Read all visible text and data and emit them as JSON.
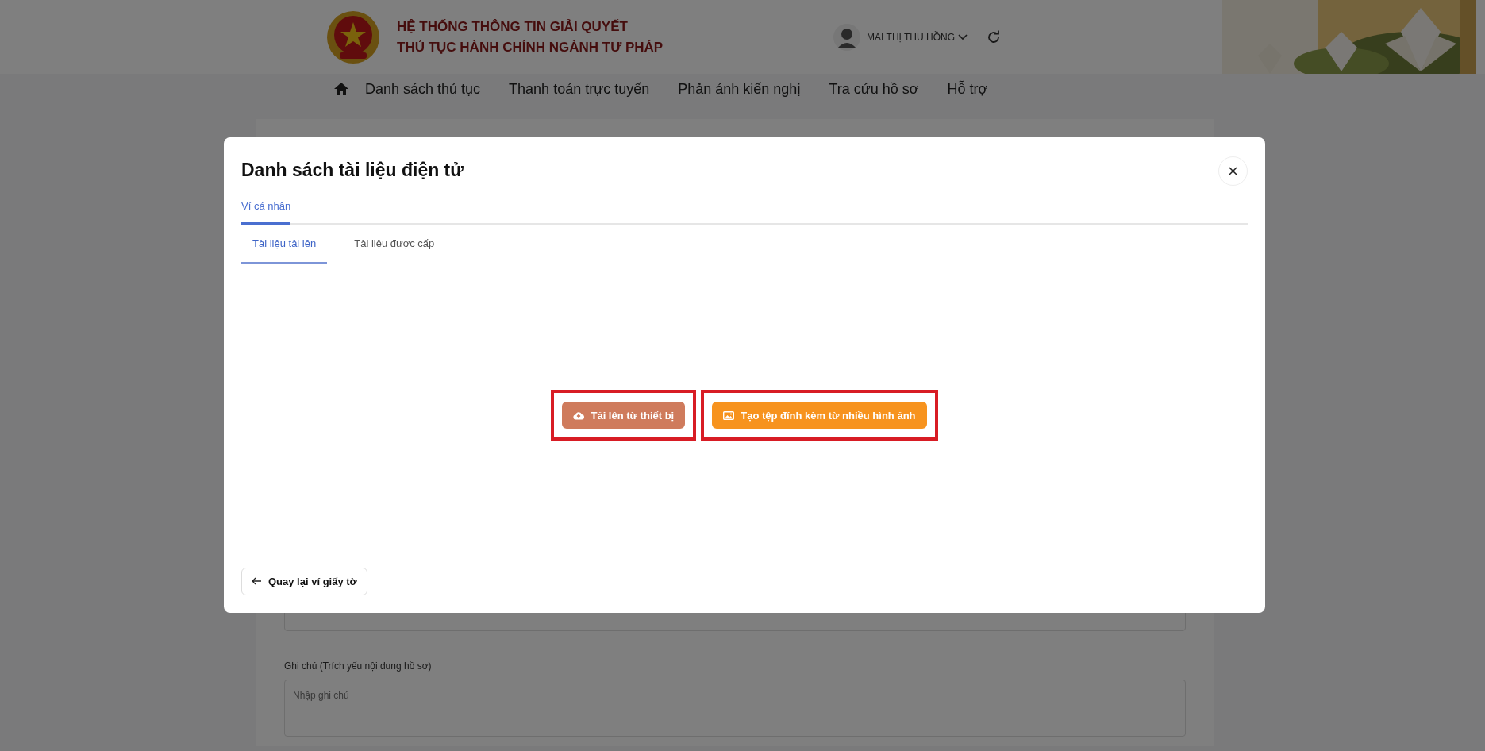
{
  "header": {
    "title_lines": [
      "HỆ THỐNG THÔNG TIN GIẢI QUYẾT",
      "THỦ TỤC HÀNH CHÍNH NGÀNH TƯ PHÁP"
    ],
    "user_name": "MAI THỊ THU HỒNG"
  },
  "nav": {
    "items": [
      "Danh sách thủ tục",
      "Thanh toán trực tuyến",
      "Phản ánh kiến nghị",
      "Tra cứu hồ sơ",
      "Hỗ trợ"
    ]
  },
  "form": {
    "note_label": "Ghi chú (Trích yếu nội dung hồ sơ)",
    "note_placeholder": "Nhập ghi chú"
  },
  "modal": {
    "title": "Danh sách tài liệu điện tử",
    "tabs": [
      {
        "label": "Ví cá nhân",
        "selected": true
      }
    ],
    "subtabs": [
      {
        "label": "Tài liệu tải lên",
        "selected": true
      },
      {
        "label": "Tài liệu được cấp",
        "selected": false
      }
    ],
    "actions": [
      {
        "label": "Tải lên từ thiết bị",
        "kind": "upload",
        "highlighted": true
      },
      {
        "label": "Tạo tệp đính kèm từ nhiều hình ảnh",
        "kind": "images",
        "highlighted": true
      }
    ],
    "back_button": "Quay lại ví giấy tờ"
  }
}
